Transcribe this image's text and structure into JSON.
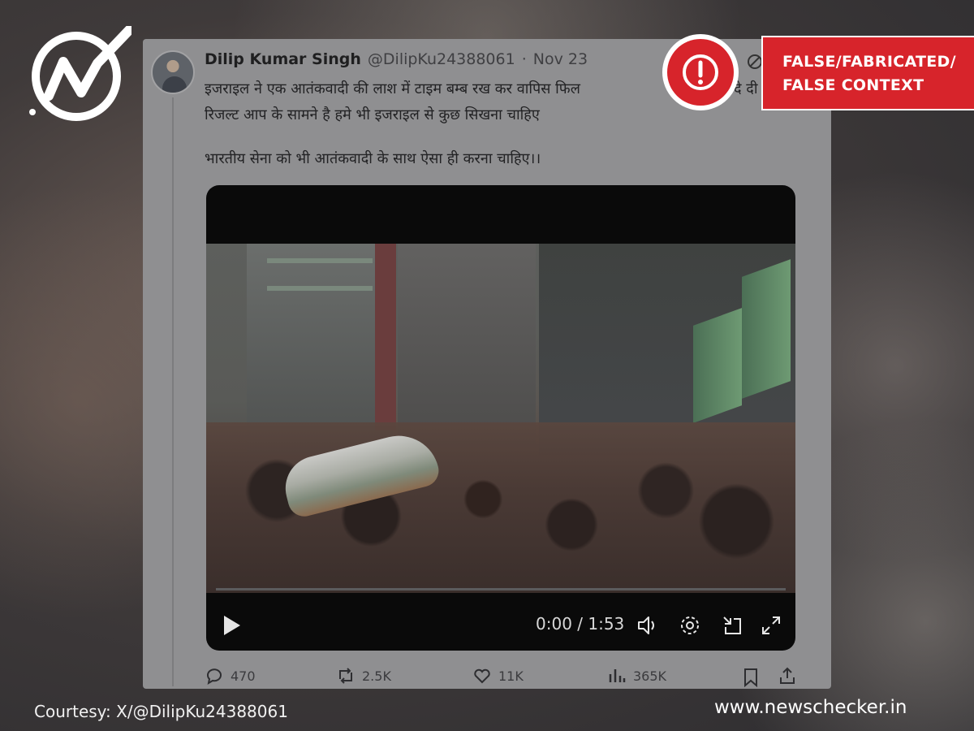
{
  "tweet": {
    "author_name": "Dilip Kumar Singh",
    "author_handle": "@DilipKu24388061",
    "separator": "·",
    "date": "Nov 23",
    "text_lines": [
      "इजराइल ने एक आतंकवादी की लाश में टाइम बम्ब रख कर वापिस फिल",
      "रिजल्ट आप के सामने है हमे भी इजराइल से कुछ सिखना चाहिए",
      "भारतीय सेना को भी आतंकवादी के साथ ऐसा ही करना चाहिए।।"
    ],
    "text_fragment_right": "दे दी",
    "video": {
      "time": "0:00 / 1:53",
      "progress_fraction": 0
    },
    "stats": {
      "replies": "470",
      "reposts": "2.5K",
      "likes": "11K",
      "views": "365K"
    }
  },
  "verdict": {
    "line1": "FALSE/FABRICATED/",
    "line2": "FALSE CONTEXT",
    "color": "#d7242b"
  },
  "courtesy": "Courtesy: X/@DilipKu24388061",
  "site": "www.newschecker.in",
  "icons": {
    "logo": "newschecker-logo-icon",
    "alert": "exclamation-icon",
    "play": "play-icon",
    "volume": "volume-icon",
    "settings": "gear-icon",
    "minimize": "minimize-icon",
    "fullscreen": "fullscreen-icon",
    "reply": "reply-icon",
    "repost": "repost-icon",
    "like": "heart-icon",
    "views": "views-icon",
    "bookmark": "bookmark-icon",
    "share": "share-icon"
  }
}
